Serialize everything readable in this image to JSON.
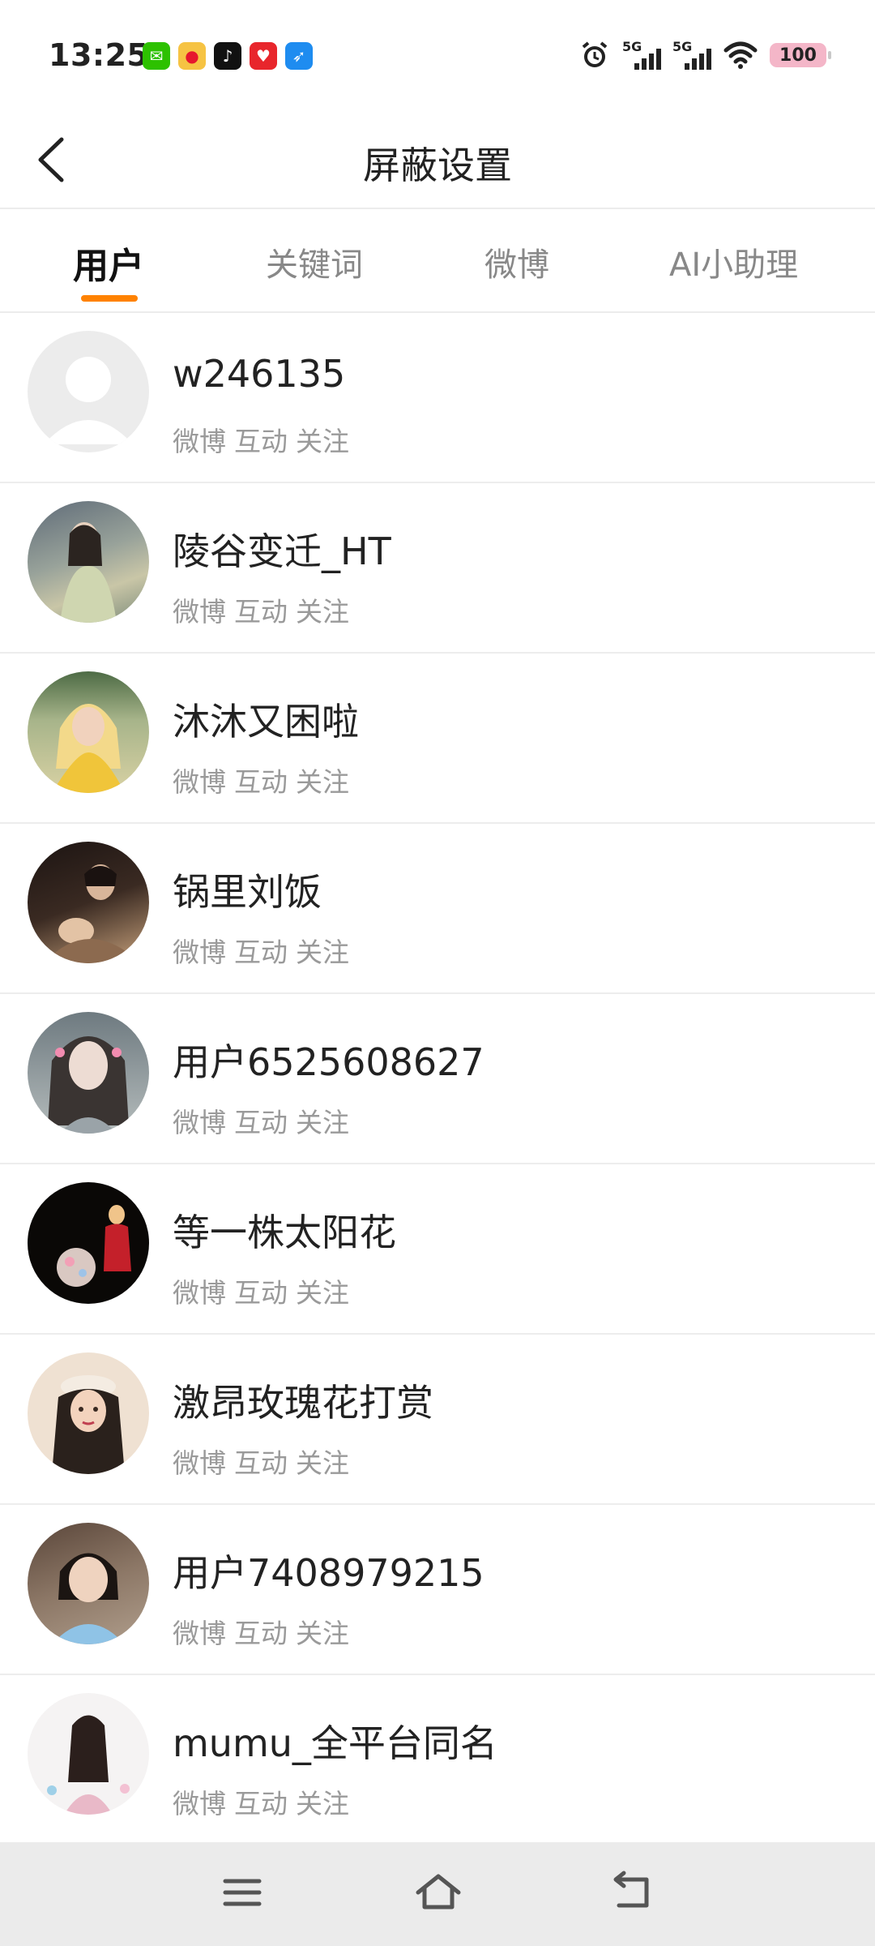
{
  "status_bar": {
    "time": "13:25",
    "app_icons": [
      "wechat-icon",
      "weibo-icon",
      "tiktok-icon",
      "heart-app-icon",
      "feather-app-icon"
    ],
    "network_labels": [
      "5G",
      "5G"
    ],
    "battery": "100"
  },
  "header": {
    "title": "屏蔽设置"
  },
  "tabs": [
    {
      "label": "用户",
      "active": true
    },
    {
      "label": "关键词",
      "active": false
    },
    {
      "label": "微博",
      "active": false
    },
    {
      "label": "AI小助理",
      "active": false
    }
  ],
  "users": [
    {
      "name": "w246135",
      "tags": [
        "微博",
        "互动",
        "关注"
      ]
    },
    {
      "name": "陵谷变迁_HT",
      "tags": [
        "微博",
        "互动",
        "关注"
      ]
    },
    {
      "name": "沐沐又困啦",
      "tags": [
        "微博",
        "互动",
        "关注"
      ]
    },
    {
      "name": "锅里刘饭",
      "tags": [
        "微博",
        "互动",
        "关注"
      ]
    },
    {
      "name": "用户6525608627",
      "tags": [
        "微博",
        "互动",
        "关注"
      ]
    },
    {
      "name": "等一株太阳花",
      "tags": [
        "微博",
        "互动",
        "关注"
      ]
    },
    {
      "name": "激昂玫瑰花打赏",
      "tags": [
        "微博",
        "互动",
        "关注"
      ]
    },
    {
      "name": "用户7408979215",
      "tags": [
        "微博",
        "互动",
        "关注"
      ]
    },
    {
      "name": "mumu_全平台同名",
      "tags": [
        "微博",
        "互动",
        "关注"
      ]
    }
  ],
  "colors": {
    "accent": "#ff8200",
    "battery_bg": "#f4b6c8",
    "navbar_bg": "#ebebeb"
  }
}
